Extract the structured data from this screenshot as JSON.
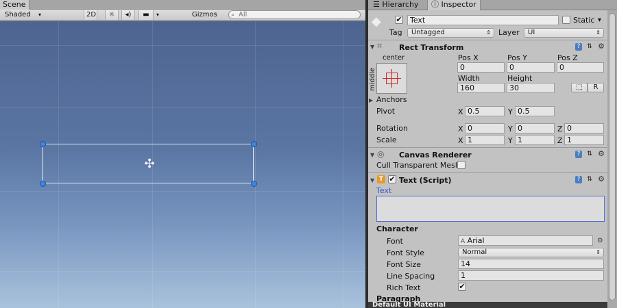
{
  "scene": {
    "tab_label": "Scene",
    "shading_mode": "Shaded",
    "mode_2d": "2D",
    "lighting_icon": "sun-icon",
    "audio_icon": "speaker-icon",
    "effects_icon": "image-icon",
    "gizmos_label": "Gizmos",
    "search_placeholder": "All"
  },
  "inspector": {
    "tabs": {
      "hierarchy": "Hierarchy",
      "inspector": "Inspector"
    },
    "object": {
      "name": "Text",
      "active": true,
      "static_label": "Static",
      "tag_label": "Tag",
      "tag_value": "Untagged",
      "layer_label": "Layer",
      "layer_value": "UI"
    },
    "rect_transform": {
      "title": "Rect Transform",
      "anchor_h": "center",
      "anchor_v": "middle",
      "pos_x_label": "Pos X",
      "pos_x": "0",
      "pos_y_label": "Pos Y",
      "pos_y": "0",
      "pos_z_label": "Pos Z",
      "pos_z": "0",
      "width_label": "Width",
      "width": "160",
      "height_label": "Height",
      "height": "30",
      "raw_edit_label": "R",
      "anchors_label": "Anchors",
      "pivot_label": "Pivot",
      "pivot_x_label": "X",
      "pivot_x": "0.5",
      "pivot_y_label": "Y",
      "pivot_y": "0.5",
      "rotation_label": "Rotation",
      "rot_x_label": "X",
      "rot_x": "0",
      "rot_y_label": "Y",
      "rot_y": "0",
      "rot_z_label": "Z",
      "rot_z": "0",
      "scale_label": "Scale",
      "scale_x_label": "X",
      "scale_x": "1",
      "scale_y_label": "Y",
      "scale_y": "1",
      "scale_z_label": "Z",
      "scale_z": "1"
    },
    "canvas_renderer": {
      "title": "Canvas Renderer",
      "cull_label": "Cull Transparent Mesh"
    },
    "text_script": {
      "title": "Text (Script)",
      "enabled": true,
      "text_label": "Text",
      "text_value": "",
      "character_label": "Character",
      "font_label": "Font",
      "font_value": "Arial",
      "font_style_label": "Font Style",
      "font_style_value": "Normal",
      "font_size_label": "Font Size",
      "font_size_value": "14",
      "line_spacing_label": "Line Spacing",
      "line_spacing_value": "1",
      "rich_text_label": "Rich Text",
      "rich_text": true,
      "paragraph_label": "Paragraph"
    },
    "material_label": "Default UI Material"
  },
  "icons": {
    "checkmark": "✔",
    "help": "?",
    "settings": "⚙",
    "preset": "⇅",
    "arrow_down": "▾",
    "arrow_right": "▸"
  },
  "colors": {
    "scene_sky_top": "#4e6490",
    "scene_sky_bottom": "#a9c2dc",
    "selection_handle": "#3f86e0",
    "text_field_focus": "#4f6cd6"
  }
}
